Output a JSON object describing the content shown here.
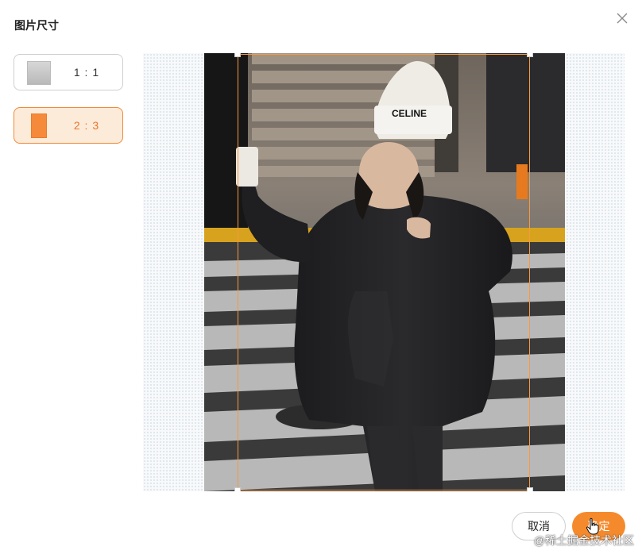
{
  "dialog": {
    "title": "图片尺寸"
  },
  "ratio_options": [
    {
      "label": "1 : 1",
      "selected": false
    },
    {
      "label": "2 : 3",
      "selected": true
    }
  ],
  "footer": {
    "cancel_label": "取消",
    "ok_label": "确定"
  },
  "watermark": "@稀土掘金技术社区",
  "colors": {
    "accent": "#f58a2d",
    "selected_bg": "#fdebd9",
    "selected_border": "#f08a3a"
  },
  "icons": {
    "close": "close-icon",
    "cursor": "hand-pointer-icon"
  }
}
